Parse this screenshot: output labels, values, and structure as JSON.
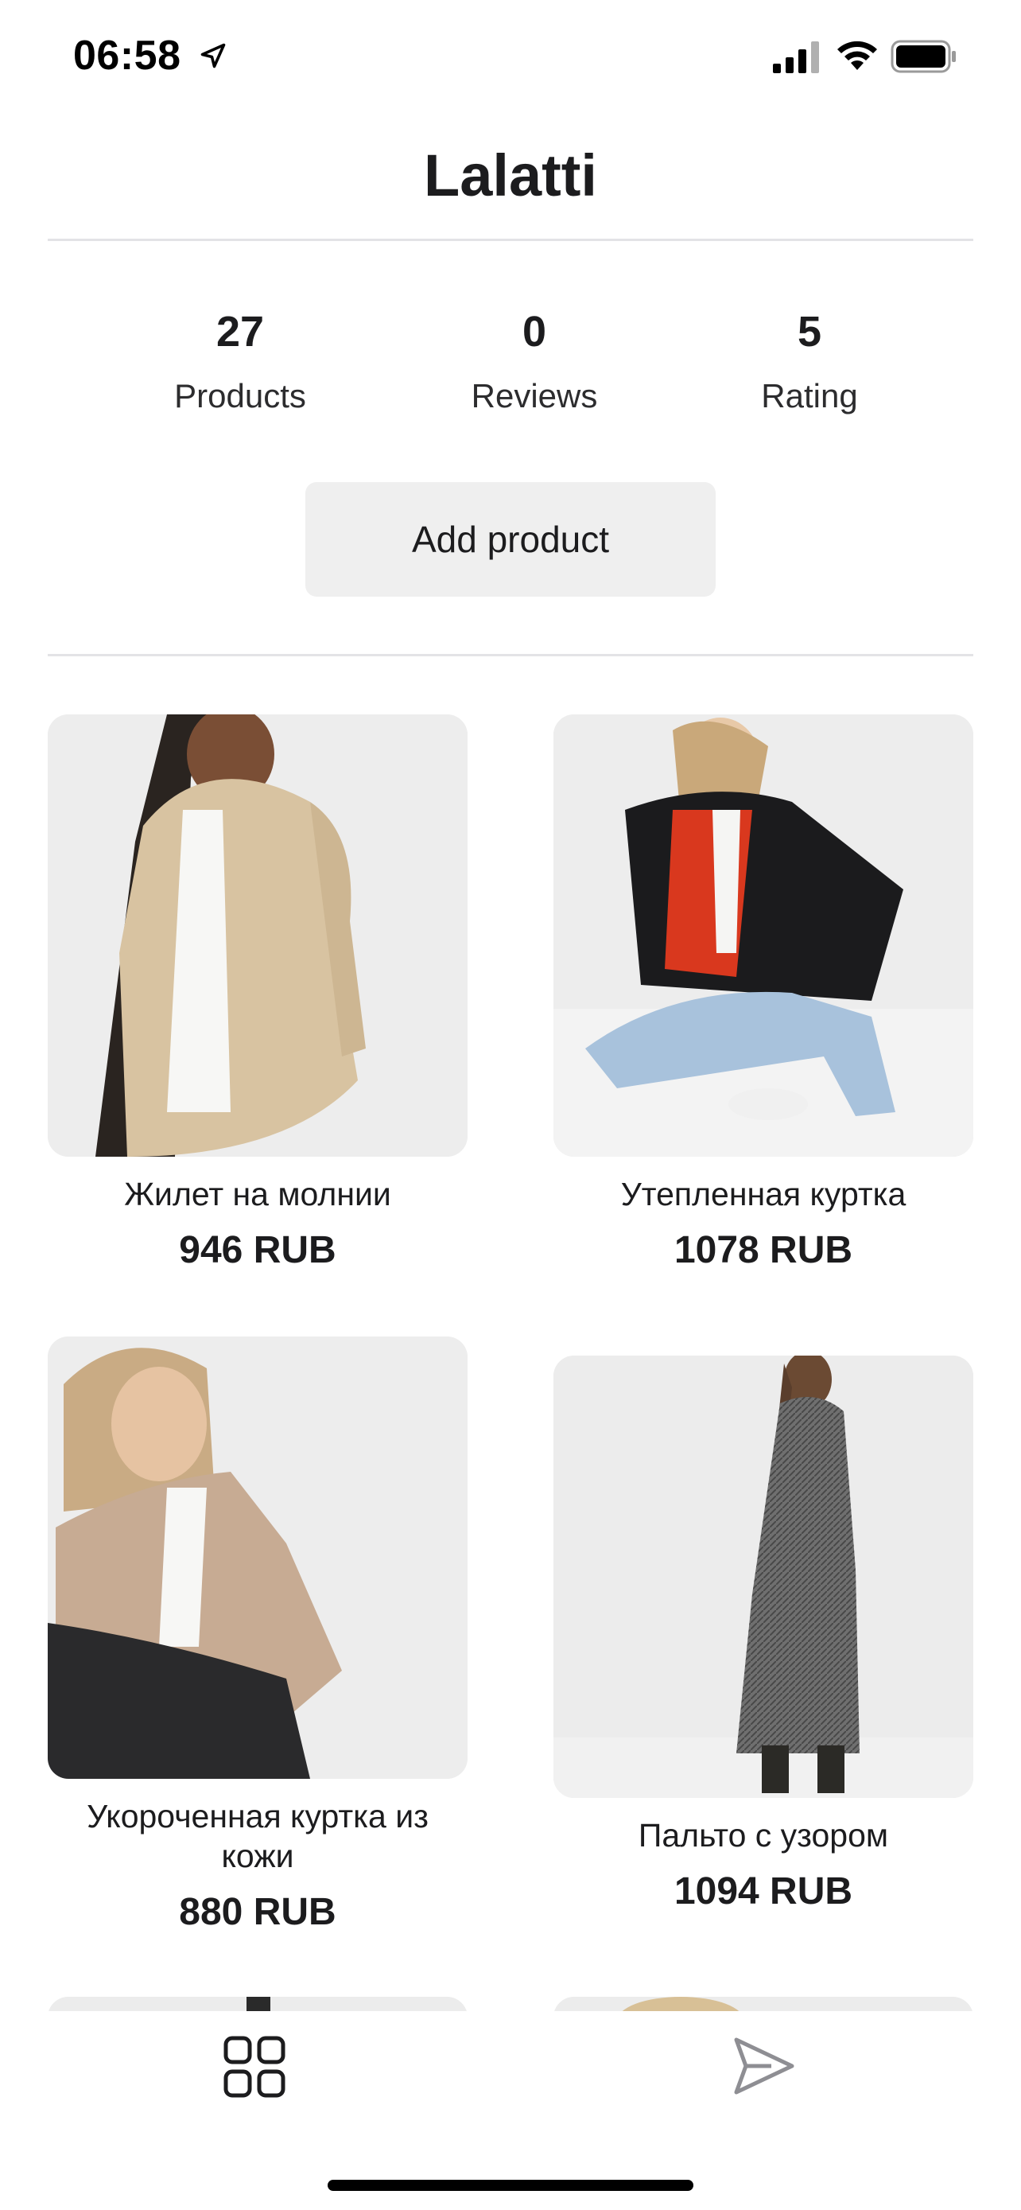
{
  "status_bar": {
    "time": "06:58",
    "icons": [
      "location-arrow-icon",
      "cellular-signal-icon",
      "wifi-icon",
      "battery-icon"
    ]
  },
  "header": {
    "title": "Lalatti"
  },
  "stats": [
    {
      "value": "27",
      "label": "Products"
    },
    {
      "value": "0",
      "label": "Reviews"
    },
    {
      "value": "5",
      "label": "Rating"
    }
  ],
  "actions": {
    "add_product_label": "Add product"
  },
  "products": [
    {
      "name": "Жилет на молнии",
      "price": "946 RUB"
    },
    {
      "name": "Утепленная куртка",
      "price": "1078 RUB"
    },
    {
      "name": "Укороченная куртка из кожи",
      "price": "880 RUB"
    },
    {
      "name": "Пальто с узором",
      "price": "1094 RUB"
    }
  ],
  "tab_bar": {
    "items": [
      {
        "icon": "grid-icon"
      },
      {
        "icon": "send-icon"
      }
    ]
  },
  "colors": {
    "text": "#1c1c1e",
    "button_bg": "#efefef",
    "divider": "#e3e3e6",
    "image_bg": "#ececec",
    "inactive_icon": "#8e8e93"
  }
}
